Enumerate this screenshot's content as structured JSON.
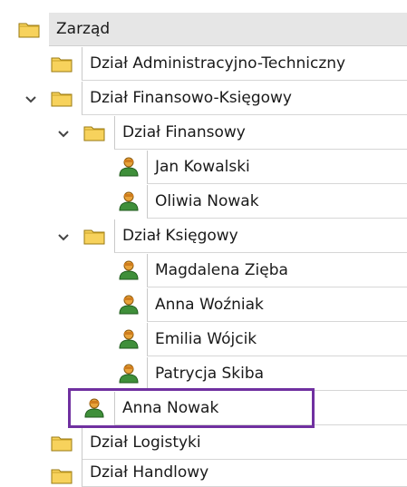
{
  "tree": {
    "root": {
      "label": "Zarząd",
      "icon": "folder-icon"
    },
    "items": [
      {
        "label": "Dział Administracyjno-Techniczny",
        "icon": "folder-icon",
        "expanded": false
      },
      {
        "label": "Dział Finansowo-Księgowy",
        "icon": "folder-icon",
        "expanded": true,
        "children": [
          {
            "label": "Dział Finansowy",
            "icon": "folder-icon",
            "expanded": true,
            "children": [
              {
                "label": "Jan Kowalski",
                "icon": "user-icon"
              },
              {
                "label": "Oliwia Nowak",
                "icon": "user-icon"
              }
            ]
          },
          {
            "label": "Dział Księgowy",
            "icon": "folder-icon",
            "expanded": true,
            "children": [
              {
                "label": "Magdalena Zięba",
                "icon": "user-icon"
              },
              {
                "label": "Anna Woźniak",
                "icon": "user-icon"
              },
              {
                "label": "Emilia Wójcik",
                "icon": "user-icon"
              },
              {
                "label": "Patrycja Skiba",
                "icon": "user-icon"
              }
            ]
          },
          {
            "label": "Anna Nowak",
            "icon": "user-icon",
            "highlighted": true
          }
        ]
      },
      {
        "label": "Dział Logistyki",
        "icon": "folder-icon",
        "expanded": false
      },
      {
        "label": "Dział Handlowy",
        "icon": "folder-icon",
        "expanded": false
      }
    ]
  },
  "colors": {
    "highlight_border": "#7030a0",
    "root_background": "#e6e6e6",
    "folder_fill": "#f7d25c",
    "user_green": "#3f8f3a",
    "user_orange": "#e8a33a"
  }
}
